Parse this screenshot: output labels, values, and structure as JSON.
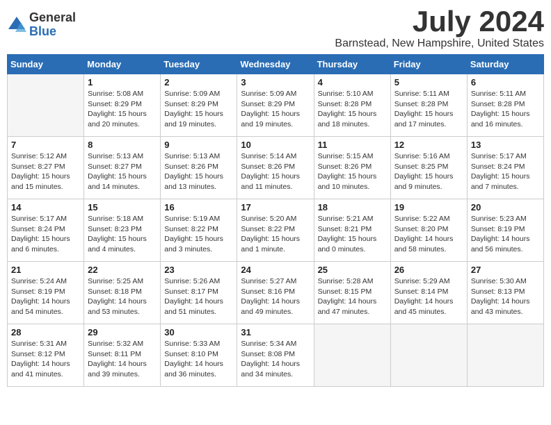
{
  "logo": {
    "general": "General",
    "blue": "Blue"
  },
  "title": "July 2024",
  "location": "Barnstead, New Hampshire, United States",
  "weekdays": [
    "Sunday",
    "Monday",
    "Tuesday",
    "Wednesday",
    "Thursday",
    "Friday",
    "Saturday"
  ],
  "weeks": [
    [
      {
        "day": null,
        "info": ""
      },
      {
        "day": "1",
        "info": "Sunrise: 5:08 AM\nSunset: 8:29 PM\nDaylight: 15 hours\nand 20 minutes."
      },
      {
        "day": "2",
        "info": "Sunrise: 5:09 AM\nSunset: 8:29 PM\nDaylight: 15 hours\nand 19 minutes."
      },
      {
        "day": "3",
        "info": "Sunrise: 5:09 AM\nSunset: 8:29 PM\nDaylight: 15 hours\nand 19 minutes."
      },
      {
        "day": "4",
        "info": "Sunrise: 5:10 AM\nSunset: 8:28 PM\nDaylight: 15 hours\nand 18 minutes."
      },
      {
        "day": "5",
        "info": "Sunrise: 5:11 AM\nSunset: 8:28 PM\nDaylight: 15 hours\nand 17 minutes."
      },
      {
        "day": "6",
        "info": "Sunrise: 5:11 AM\nSunset: 8:28 PM\nDaylight: 15 hours\nand 16 minutes."
      }
    ],
    [
      {
        "day": "7",
        "info": "Sunrise: 5:12 AM\nSunset: 8:27 PM\nDaylight: 15 hours\nand 15 minutes."
      },
      {
        "day": "8",
        "info": "Sunrise: 5:13 AM\nSunset: 8:27 PM\nDaylight: 15 hours\nand 14 minutes."
      },
      {
        "day": "9",
        "info": "Sunrise: 5:13 AM\nSunset: 8:26 PM\nDaylight: 15 hours\nand 13 minutes."
      },
      {
        "day": "10",
        "info": "Sunrise: 5:14 AM\nSunset: 8:26 PM\nDaylight: 15 hours\nand 11 minutes."
      },
      {
        "day": "11",
        "info": "Sunrise: 5:15 AM\nSunset: 8:26 PM\nDaylight: 15 hours\nand 10 minutes."
      },
      {
        "day": "12",
        "info": "Sunrise: 5:16 AM\nSunset: 8:25 PM\nDaylight: 15 hours\nand 9 minutes."
      },
      {
        "day": "13",
        "info": "Sunrise: 5:17 AM\nSunset: 8:24 PM\nDaylight: 15 hours\nand 7 minutes."
      }
    ],
    [
      {
        "day": "14",
        "info": "Sunrise: 5:17 AM\nSunset: 8:24 PM\nDaylight: 15 hours\nand 6 minutes."
      },
      {
        "day": "15",
        "info": "Sunrise: 5:18 AM\nSunset: 8:23 PM\nDaylight: 15 hours\nand 4 minutes."
      },
      {
        "day": "16",
        "info": "Sunrise: 5:19 AM\nSunset: 8:22 PM\nDaylight: 15 hours\nand 3 minutes."
      },
      {
        "day": "17",
        "info": "Sunrise: 5:20 AM\nSunset: 8:22 PM\nDaylight: 15 hours\nand 1 minute."
      },
      {
        "day": "18",
        "info": "Sunrise: 5:21 AM\nSunset: 8:21 PM\nDaylight: 15 hours\nand 0 minutes."
      },
      {
        "day": "19",
        "info": "Sunrise: 5:22 AM\nSunset: 8:20 PM\nDaylight: 14 hours\nand 58 minutes."
      },
      {
        "day": "20",
        "info": "Sunrise: 5:23 AM\nSunset: 8:19 PM\nDaylight: 14 hours\nand 56 minutes."
      }
    ],
    [
      {
        "day": "21",
        "info": "Sunrise: 5:24 AM\nSunset: 8:19 PM\nDaylight: 14 hours\nand 54 minutes."
      },
      {
        "day": "22",
        "info": "Sunrise: 5:25 AM\nSunset: 8:18 PM\nDaylight: 14 hours\nand 53 minutes."
      },
      {
        "day": "23",
        "info": "Sunrise: 5:26 AM\nSunset: 8:17 PM\nDaylight: 14 hours\nand 51 minutes."
      },
      {
        "day": "24",
        "info": "Sunrise: 5:27 AM\nSunset: 8:16 PM\nDaylight: 14 hours\nand 49 minutes."
      },
      {
        "day": "25",
        "info": "Sunrise: 5:28 AM\nSunset: 8:15 PM\nDaylight: 14 hours\nand 47 minutes."
      },
      {
        "day": "26",
        "info": "Sunrise: 5:29 AM\nSunset: 8:14 PM\nDaylight: 14 hours\nand 45 minutes."
      },
      {
        "day": "27",
        "info": "Sunrise: 5:30 AM\nSunset: 8:13 PM\nDaylight: 14 hours\nand 43 minutes."
      }
    ],
    [
      {
        "day": "28",
        "info": "Sunrise: 5:31 AM\nSunset: 8:12 PM\nDaylight: 14 hours\nand 41 minutes."
      },
      {
        "day": "29",
        "info": "Sunrise: 5:32 AM\nSunset: 8:11 PM\nDaylight: 14 hours\nand 39 minutes."
      },
      {
        "day": "30",
        "info": "Sunrise: 5:33 AM\nSunset: 8:10 PM\nDaylight: 14 hours\nand 36 minutes."
      },
      {
        "day": "31",
        "info": "Sunrise: 5:34 AM\nSunset: 8:08 PM\nDaylight: 14 hours\nand 34 minutes."
      },
      {
        "day": null,
        "info": ""
      },
      {
        "day": null,
        "info": ""
      },
      {
        "day": null,
        "info": ""
      }
    ]
  ]
}
